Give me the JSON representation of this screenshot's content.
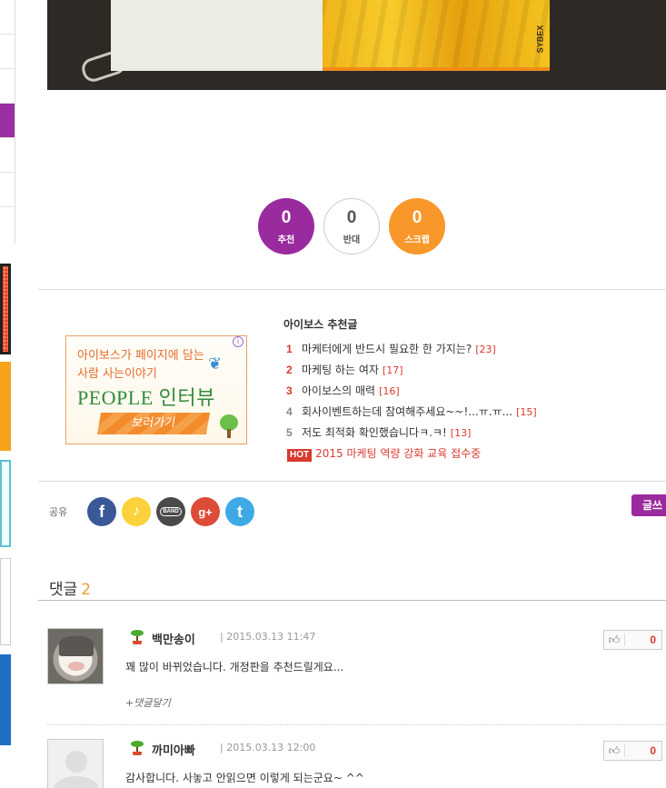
{
  "votes": {
    "up": {
      "count": "0",
      "label": "추천"
    },
    "down": {
      "count": "0",
      "label": "반대"
    },
    "scrap": {
      "count": "0",
      "label": "스크랩"
    }
  },
  "hero": {
    "brand": "SYBEX"
  },
  "ad_banner": {
    "line1": "아이보스가 페이지에 담는",
    "line2": "사람 사는이야기",
    "title": "PEOPLE 인터뷰",
    "cta": "보러가기",
    "info_icon": "info-icon"
  },
  "recommended": {
    "title": "아이보스 추천글",
    "items": [
      {
        "rank": "1",
        "title": "마케터에게 반드시 필요한 한 가지는?",
        "count": "[23]"
      },
      {
        "rank": "2",
        "title": "마케팅 하는 여자",
        "count": "[17]"
      },
      {
        "rank": "3",
        "title": "아이보스의 매력",
        "count": "[16]"
      },
      {
        "rank": "4",
        "title": "회사이벤트하는데 참여해주세요~~!...ㅠ.ㅠ...",
        "count": "[15]"
      },
      {
        "rank": "5",
        "title": "저도 최적화 확인했습니다ㅋ.ㅋ!",
        "count": "[13]"
      }
    ],
    "hot": {
      "tag": "HOT",
      "text": "2015 마케팅 역량 강화 교육 접수중"
    }
  },
  "share": {
    "label": "공유",
    "icons": {
      "facebook": "f",
      "kakaostory": "♪",
      "band": "BAND",
      "googleplus": "g+",
      "twitter": "t"
    }
  },
  "write_button": "글쓰",
  "comments": {
    "label": "댓글",
    "count": "2",
    "items": [
      {
        "author": "백만송이",
        "date": "| 2015.03.13 11:47",
        "body": "꽤 많이 바뀌었습니다. 개정판을 추천드릴게요...",
        "reply": "+댓글달기",
        "likes": "0"
      },
      {
        "author": "까미아빠",
        "date": "| 2015.03.13 12:00",
        "body": "감사합니다. 사놓고 안읽으면 이렇게 되는군요~ ^^",
        "likes": "0"
      }
    ]
  },
  "colors": {
    "accent": "#9a2b9e",
    "scrap": "#f8972a",
    "highlight": "#d93a2f"
  }
}
